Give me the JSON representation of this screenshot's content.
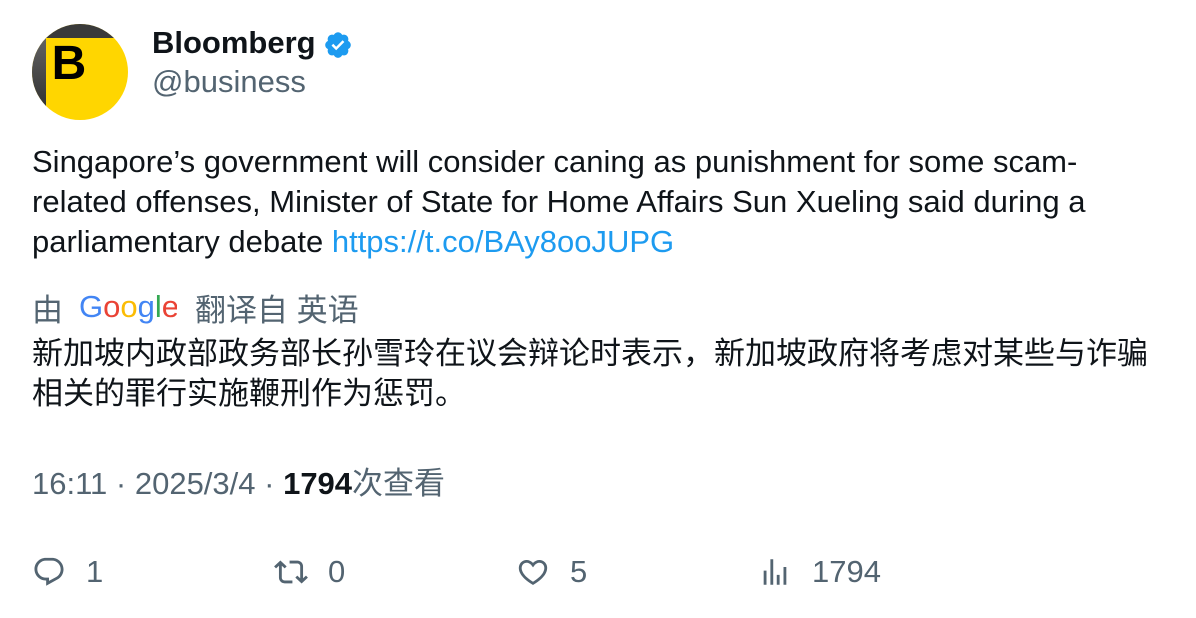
{
  "author": {
    "display_name": "Bloomberg",
    "handle": "@business",
    "avatar_letter": "B",
    "avatar_color": "#ffd600",
    "verified_color": "#1d9bf0"
  },
  "tweet": {
    "text": "Singapore’s government will consider caning as punishment for some scam-related offenses, Minister of State for Home Affairs Sun Xueling said during a parliamentary debate ",
    "link": "https://t.co/BAy8ooJUPG",
    "link_color": "#1d9bf0"
  },
  "translation": {
    "by_label": "由",
    "google_logo": "Google",
    "source_label": "翻译自 英语",
    "text": "新加坡内政部政务部长孙雪玲在议会辩论时表示，新加坡政府将考虑对某些与诈骗相关的罪行实施鞭刑作为惩罚。"
  },
  "meta": {
    "time": "16:11",
    "separator": " · ",
    "date": "2025/3/4",
    "views_count": "1794",
    "views_label": "次查看"
  },
  "actions": {
    "reply": {
      "icon": "reply-icon",
      "count": "1"
    },
    "retweet": {
      "icon": "retweet-icon",
      "count": "0"
    },
    "like": {
      "icon": "heart-icon",
      "count": "5"
    },
    "views": {
      "icon": "views-icon",
      "count": "1794"
    }
  }
}
